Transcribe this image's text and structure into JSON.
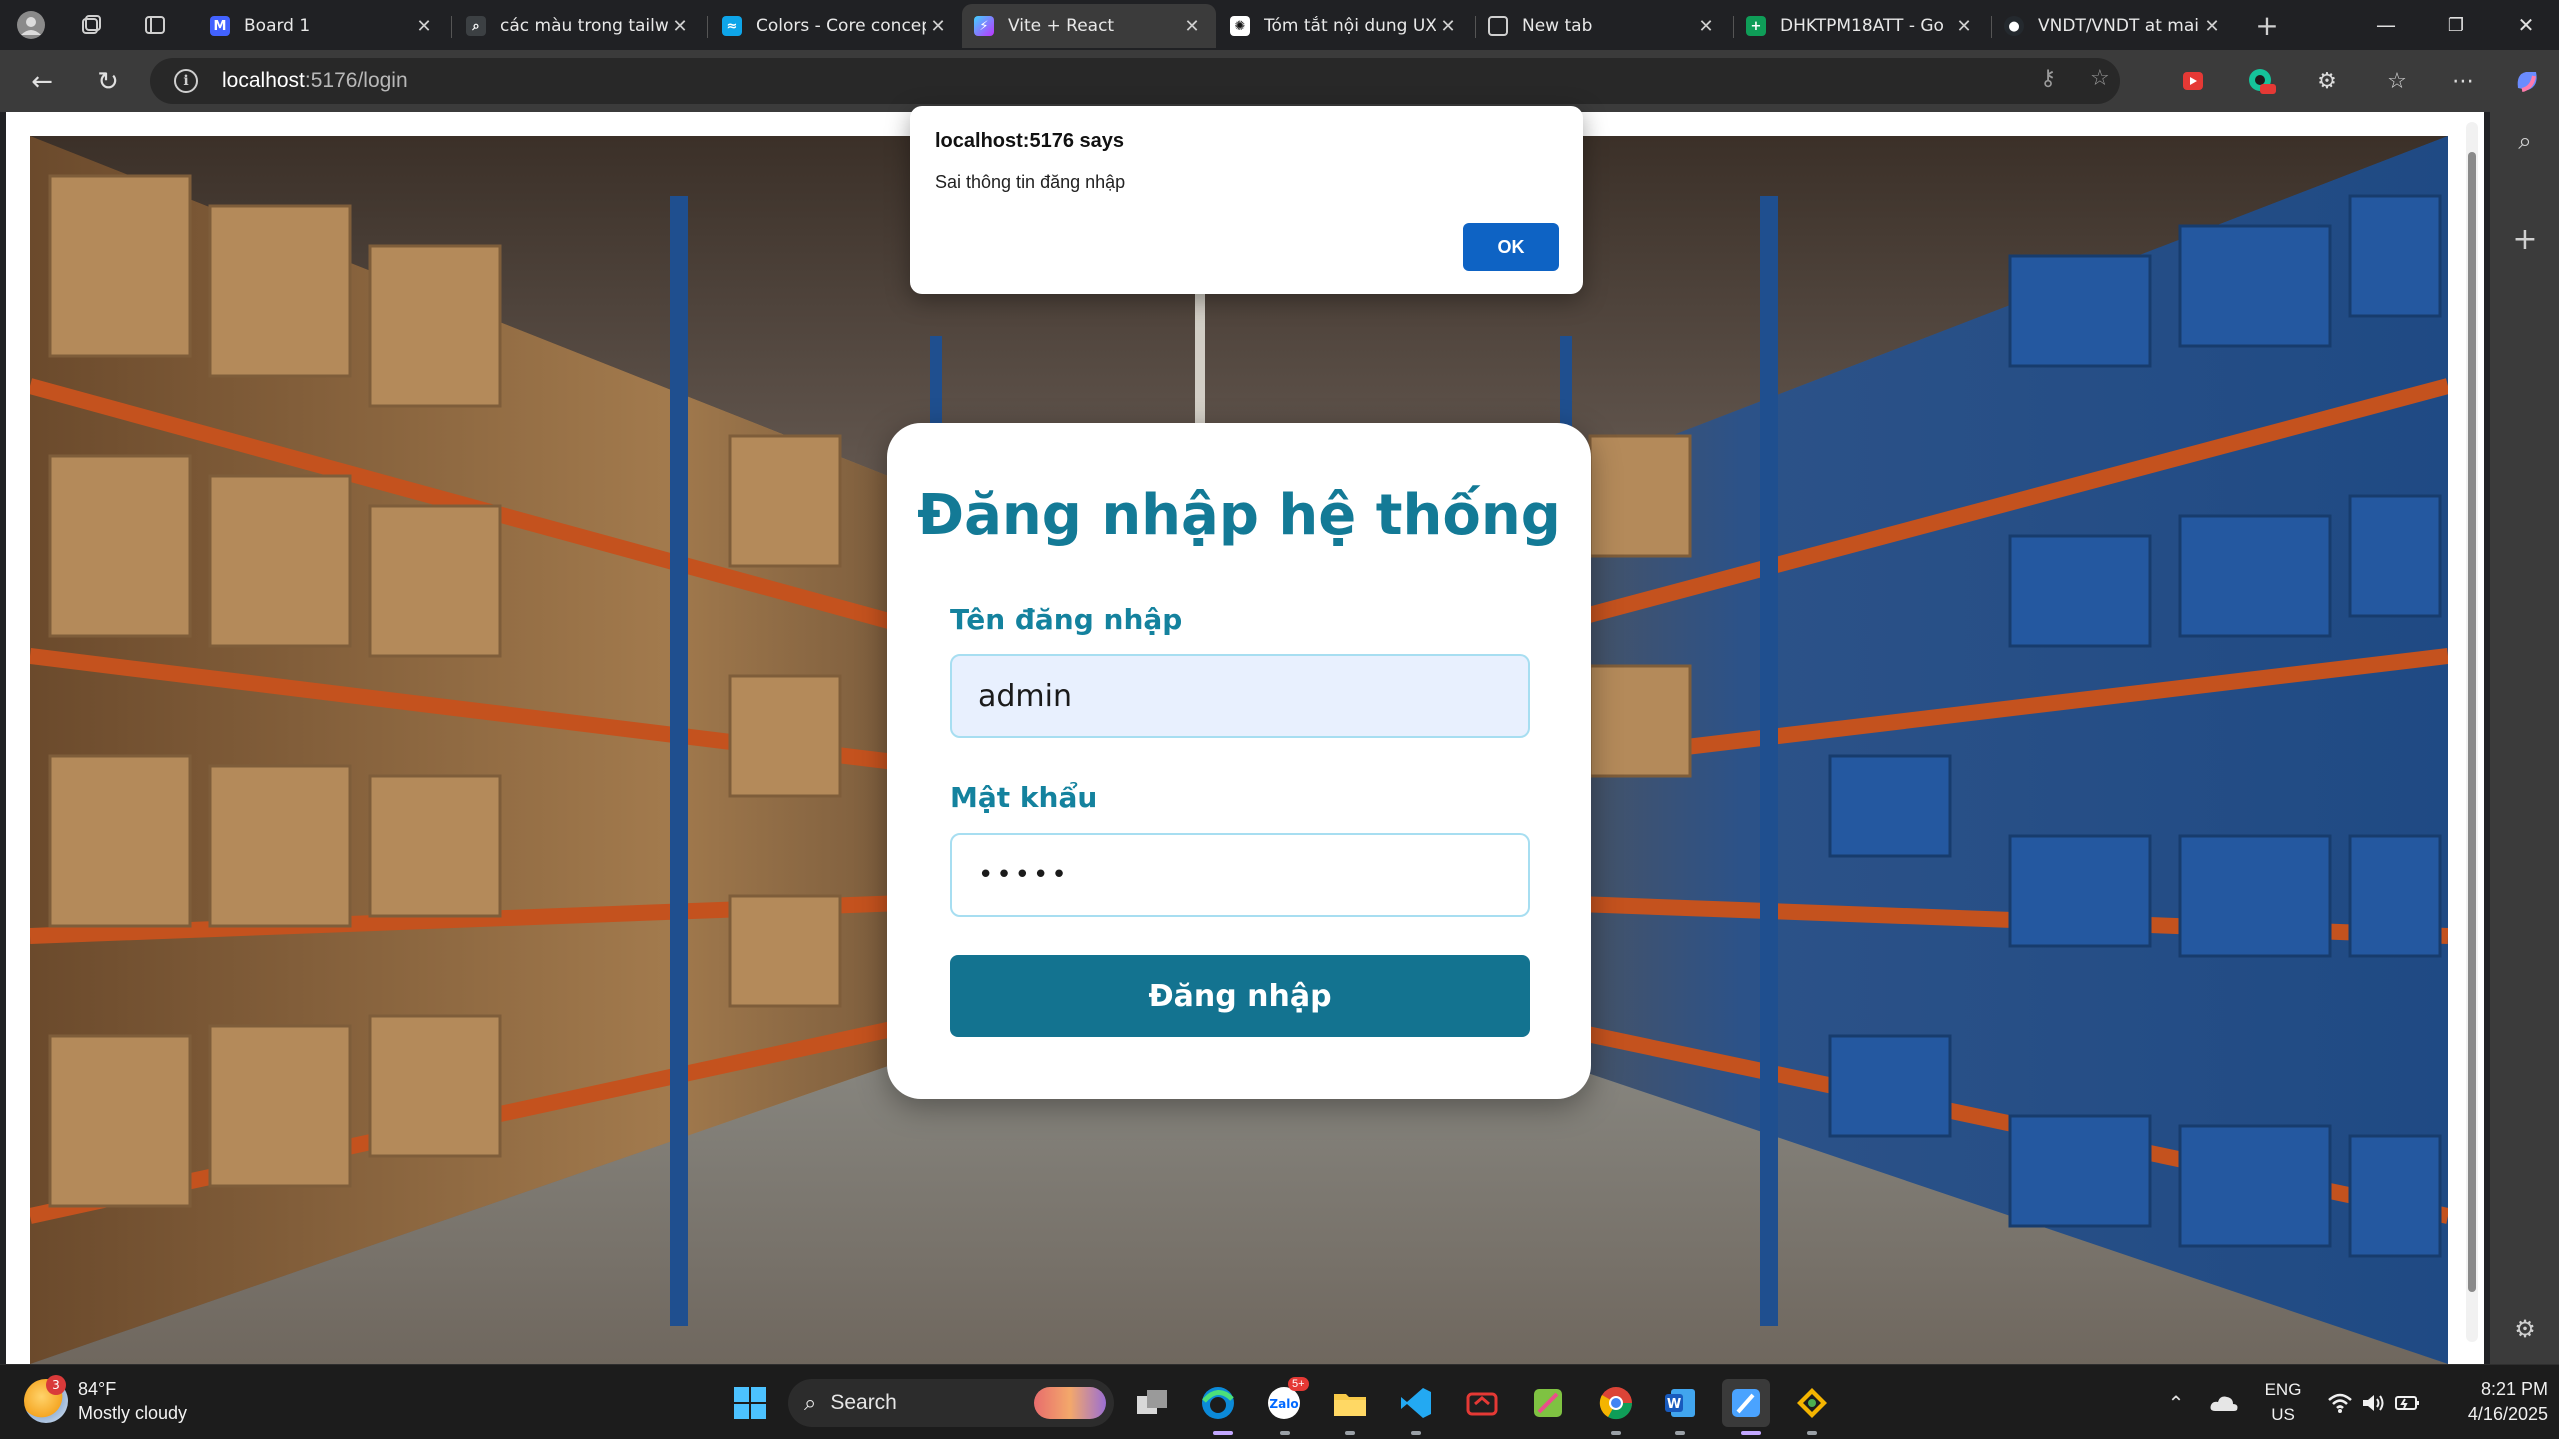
{
  "browser": {
    "tabs": [
      {
        "title": "Board 1",
        "icon": "miro-icon",
        "color": "#4262ff",
        "active": false
      },
      {
        "title": "các màu trong tailwi",
        "icon": "search-icon",
        "color": "#3c4043",
        "active": false
      },
      {
        "title": "Colors - Core concep",
        "icon": "tailwind-icon",
        "color": "#38bdf8",
        "active": false
      },
      {
        "title": "Vite + React",
        "icon": "vite-icon",
        "color": "#a855f7",
        "active": true
      },
      {
        "title": "Tóm tắt nội dung UX",
        "icon": "chatgpt-icon",
        "color": "#222222",
        "active": false
      },
      {
        "title": "New tab",
        "icon": "newtab-icon",
        "color": "#555555",
        "active": false
      },
      {
        "title": "DHKTPM18ATT - Go",
        "icon": "sheets-icon",
        "color": "#0f9d58",
        "active": false
      },
      {
        "title": "VNDT/VNDT at main",
        "icon": "github-icon",
        "color": "#24292e",
        "active": false
      }
    ],
    "address": {
      "host": "localhost",
      "path": ":5176/login"
    }
  },
  "alert": {
    "title": "localhost:5176 says",
    "message": "Sai thông tin đăng nhập",
    "ok_label": "OK"
  },
  "login": {
    "heading": "Đăng nhập hệ thống",
    "username_label": "Tên đăng nhập",
    "username_value": "admin",
    "password_label": "Mật khẩu",
    "password_value": "•••••",
    "submit_label": "Đăng nhập"
  },
  "taskbar": {
    "weather_temp": "84°F",
    "weather_desc": "Mostly cloudy",
    "weather_badge": "3",
    "search_label": "Search",
    "lang_top": "ENG",
    "lang_bottom": "US",
    "time": "8:21 PM",
    "date": "4/16/2025",
    "zalo_badge": "5+"
  },
  "colors": {
    "accent": "#137a96",
    "button": "#137390",
    "dialog_ok": "#0e63c4"
  }
}
